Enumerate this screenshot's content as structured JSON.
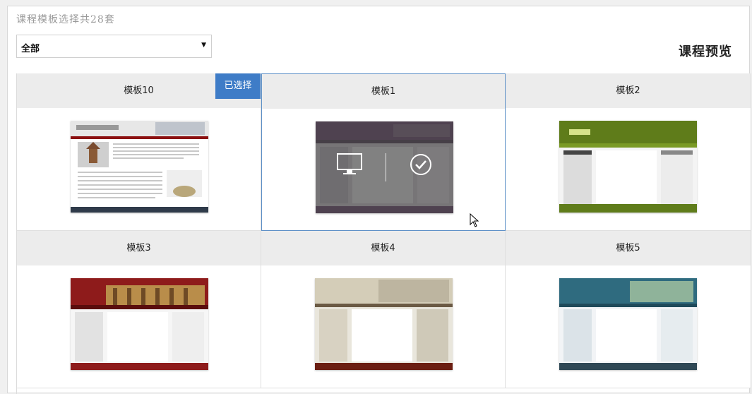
{
  "header": {
    "count_text": "课程模板选择共28套",
    "category_value": "全部",
    "preview_label": "课程预览",
    "selected_badge": "已选择"
  },
  "templates": [
    {
      "name": "模板10",
      "selected": true
    },
    {
      "name": "模板1",
      "hovered": true
    },
    {
      "name": "模板2"
    },
    {
      "name": "模板3"
    },
    {
      "name": "模板4"
    },
    {
      "name": "模板5"
    }
  ],
  "icons": {
    "dropdown": "chevron-down-icon",
    "monitor": "monitor-icon",
    "check": "check-circle-icon",
    "cursor": "mouse-pointer-icon"
  },
  "colors": {
    "accent": "#3e7cc7",
    "hover_border": "#5d90c7",
    "bar": "#ececec"
  }
}
